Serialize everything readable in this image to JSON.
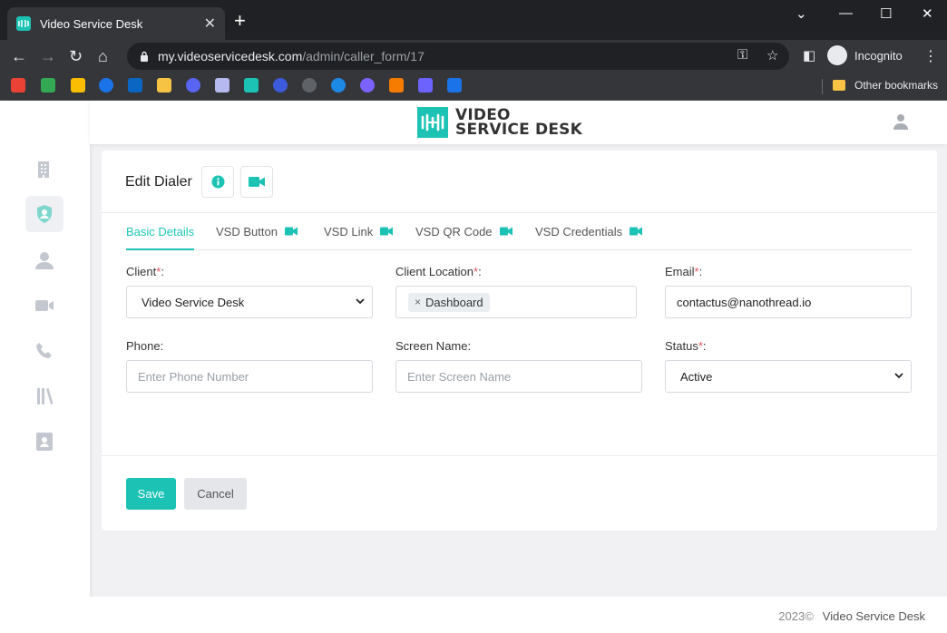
{
  "browser": {
    "tab_title": "Video Service Desk",
    "tab_close": "✕",
    "new_tab": "+",
    "url_host": "my.videoservicedesk.com",
    "url_path": "/admin/caller_form/17",
    "incognito_label": "Incognito",
    "other_bookmarks": "Other bookmarks"
  },
  "header": {
    "logo_line1": "VIDEO",
    "logo_line2": "SERVICE DESK"
  },
  "page": {
    "title": "Edit Dialer"
  },
  "tabs": [
    {
      "label": "Basic Details",
      "active": true
    },
    {
      "label": "VSD Button"
    },
    {
      "label": "VSD Link"
    },
    {
      "label": "VSD QR Code"
    },
    {
      "label": "VSD Credentials"
    }
  ],
  "form": {
    "client": {
      "label": "Client",
      "required": "*",
      "suffix": ":",
      "value": "Video Service Desk"
    },
    "client_location": {
      "label": "Client Location",
      "required": "*",
      "suffix": ":",
      "chip": "Dashboard",
      "chip_remove": "×"
    },
    "email": {
      "label": "Email",
      "required": "*",
      "suffix": ":",
      "value": "contactus@nanothread.io"
    },
    "phone": {
      "label": "Phone:",
      "placeholder": "Enter Phone Number"
    },
    "screen_name": {
      "label": "Screen Name:",
      "placeholder": "Enter Screen Name"
    },
    "status": {
      "label": "Status",
      "required": "*",
      "suffix": ":",
      "value": "Active"
    }
  },
  "actions": {
    "save": "Save",
    "cancel": "Cancel"
  },
  "footer": {
    "year": "2023©",
    "brand": "Video Service Desk"
  },
  "colors": {
    "accent": "#1cc3b5",
    "required": "#e5535f"
  }
}
